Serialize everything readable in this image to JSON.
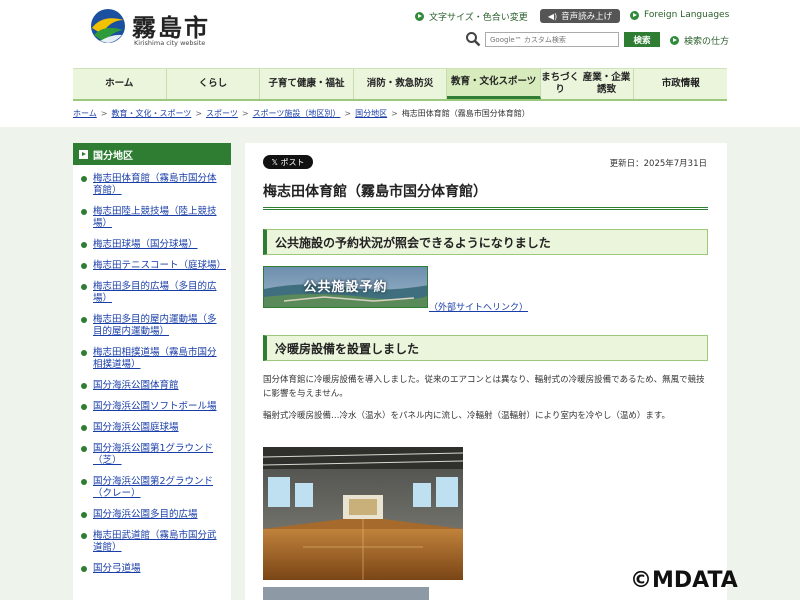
{
  "header": {
    "logo_title": "霧島市",
    "logo_subtitle": "Kirishima city website",
    "links": {
      "font_size": "文字サイズ・色合い変更",
      "foreign": "Foreign Languages",
      "search_help": "検索の仕方"
    },
    "voice_label": "音声読み上げ",
    "search": {
      "placeholder": "Google™ カスタム検索",
      "button": "検索"
    }
  },
  "nav": {
    "items": [
      {
        "line1": "ホーム",
        "line2": ""
      },
      {
        "line1": "くらし",
        "line2": ""
      },
      {
        "line1": "子育て",
        "line2": "健康・福祉"
      },
      {
        "line1": "消防・救急",
        "line2": "防災"
      },
      {
        "line1": "教育・文化",
        "line2": "スポーツ"
      },
      {
        "line1": "まちづくり",
        "line2": "産業・企業誘致"
      },
      {
        "line1": "市政情報",
        "line2": ""
      }
    ],
    "active_index": 4
  },
  "breadcrumb": {
    "links": [
      "ホーム",
      "教育・文化・スポーツ",
      "スポーツ",
      "スポーツ施設（地区別）",
      "国分地区"
    ],
    "current": "梅志田体育館（霧島市国分体育館）"
  },
  "sidebar": {
    "heading": "国分地区",
    "items": [
      "梅志田体育館（霧島市国分体育館）",
      "梅志田陸上競技場（陸上競技場）",
      "梅志田球場（国分球場）",
      "梅志田テニスコート（庭球場）",
      "梅志田多目的広場（多目的広場）",
      "梅志田多目的屋内運動場（多目的屋内運動場）",
      "梅志田相撲道場（霧島市国分相撲道場）",
      "国分海浜公園体育館",
      "国分海浜公園ソフトボール場",
      "国分海浜公園庭球場",
      "国分海浜公園第1グラウンド（芝）",
      "国分海浜公園第2グラウンド（クレー）",
      "国分海浜公園多目的広場",
      "梅志田武道館（霧島市国分武道館）",
      "国分弓道場"
    ]
  },
  "main": {
    "x_post": "𝕏 ポスト",
    "updated": "更新日：2025年7月31日",
    "title": "梅志田体育館（霧島市国分体育館）",
    "section1": {
      "heading": "公共施設の予約状況が照会できるようになりました",
      "banner_text": "公共施設予約",
      "external_link": "（外部サイトへリンク）"
    },
    "section2": {
      "heading": "冷暖房設備を設置しました",
      "para1": "国分体育館に冷暖房設備を導入しました。従来のエアコンとは異なり、輻射式の冷暖房設備であるため、無風で競技に影響を与えません。",
      "para2": "輻射式冷暖房設備…冷水（温水）をパネル内に流し、冷輻射（温輻射）により室内を冷やし（温め）ます。"
    }
  },
  "watermark": "©MDATA",
  "colors": {
    "brand_green": "#2e7d32",
    "nav_bg": "#eaf5dc",
    "link": "#1a3ea8"
  }
}
